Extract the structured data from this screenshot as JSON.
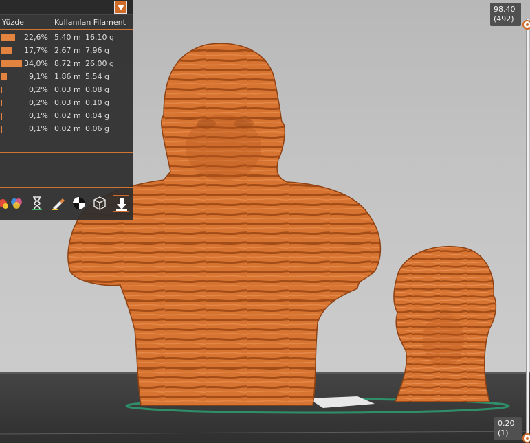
{
  "legend": {
    "header": {
      "col_percent": "Yüzde",
      "col_used": "Kullanılan Filament",
      "dropdown_icon": "chevron-down-icon"
    },
    "rows": [
      {
        "percent": "22,6%",
        "length": "5.40 m",
        "weight": "16.10 g",
        "fraction": 0.226
      },
      {
        "percent": "17,7%",
        "length": "2.67 m",
        "weight": "7.96 g",
        "fraction": 0.177
      },
      {
        "percent": "34,0%",
        "length": "8.72 m",
        "weight": "26.00 g",
        "fraction": 0.34
      },
      {
        "percent": "9,1%",
        "length": "1.86 m",
        "weight": "5.54 g",
        "fraction": 0.091
      },
      {
        "percent": "0,2%",
        "length": "0.03 m",
        "weight": "0.08 g",
        "fraction": 0.002
      },
      {
        "percent": "0,2%",
        "length": "0.03 m",
        "weight": "0.10 g",
        "fraction": 0.002
      },
      {
        "percent": "0,1%",
        "length": "0.02 m",
        "weight": "0.04 g",
        "fraction": 0.001
      },
      {
        "percent": "0,1%",
        "length": "0.02 m",
        "weight": "0.06 g",
        "fraction": 0.001
      }
    ],
    "bar_color": "#e2833f"
  },
  "toolbar": {
    "tools": [
      {
        "name": "color-print-icon"
      },
      {
        "name": "hourglass-icon"
      },
      {
        "name": "paint-brush-icon"
      },
      {
        "name": "center-of-mass-icon"
      },
      {
        "name": "wireframe-cube-icon"
      },
      {
        "name": "export-icon"
      }
    ]
  },
  "layer_slider": {
    "top_height": "98.40",
    "top_layer": "(492)",
    "bottom_height": "0.20",
    "bottom_layer": "(1)"
  },
  "colors": {
    "model": "#d0702f",
    "accent": "#d06c2a",
    "panel": "#2d2d2d"
  }
}
